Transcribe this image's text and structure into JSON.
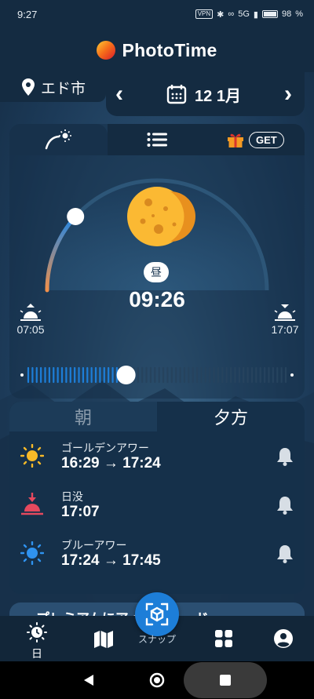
{
  "status_bar": {
    "time": "9:27",
    "vpn_label": "VPN",
    "network_label": "5G",
    "battery": "98",
    "battery_level": 0.98
  },
  "header": {
    "app_title": "PhotoTime"
  },
  "location": {
    "name": "エド市"
  },
  "date": {
    "label": "12 1月"
  },
  "tabs": {
    "get_label": "GET"
  },
  "sun_panel": {
    "day_badge": "昼",
    "current_time": "09:26",
    "sunrise_time": "07:05",
    "sunset_time": "17:07",
    "slider_position": 0.38
  },
  "period_tabs": {
    "morning": "朝",
    "evening": "夕方"
  },
  "events": [
    {
      "label": "ゴールデンアワー",
      "time": "16:29 → 17:24",
      "icon": "sun-icon",
      "color": "#f7b928"
    },
    {
      "label": "日没",
      "time": "17:07",
      "icon": "sunset-icon",
      "color": "#e5495e"
    },
    {
      "label": "ブルーアワー",
      "time": "17:24 → 17:45",
      "icon": "sun-icon",
      "color": "#2f93f0"
    }
  ],
  "promo": {
    "text": "プレミアムにアップグレード"
  },
  "bottom_nav": {
    "day_label": "日",
    "fab_label": "スナップ"
  },
  "colors": {
    "accent": "#1d7ed8",
    "sunrise_orange": "#f2904a",
    "gold": "#f7b928"
  }
}
